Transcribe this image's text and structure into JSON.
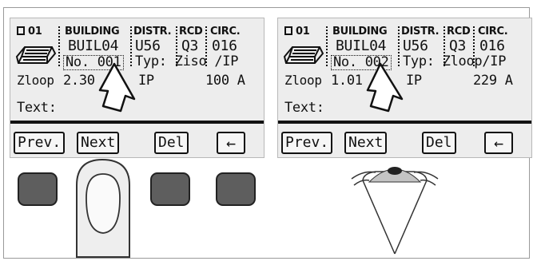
{
  "left_panel": {
    "id_label": "01",
    "headers": {
      "building": "BUILDING",
      "distr": "DISTR.",
      "rcd": "RCD",
      "circ": "CIRC."
    },
    "building_value": "BUIL04",
    "distr_value": "U56",
    "rcd_value": "Q3",
    "circ_value": "016",
    "number": "No. 001",
    "typ": "Typ: Ziso /IP",
    "z_label": "Zloop",
    "z_value": "2.30",
    "ip_label": "IP",
    "ip_value": "100 A",
    "text_label": "Text:",
    "softkeys": {
      "prev": "Prev.",
      "next": "Next",
      "del": "Del",
      "back": "←"
    }
  },
  "right_panel": {
    "id_label": "01",
    "headers": {
      "building": "BUILDING",
      "distr": "DISTR.",
      "rcd": "RCD",
      "circ": "CIRC."
    },
    "building_value": "BUIL04",
    "distr_value": "U56",
    "rcd_value": "Q3",
    "circ_value": "016",
    "number": "No. 002",
    "typ": "Typ: Zloop/IP",
    "z_label": "Zloop",
    "z_value": "1.01",
    "ip_label": "IP",
    "ip_value": "229 A",
    "text_label": "Text:",
    "softkeys": {
      "prev": "Prev.",
      "next": "Next",
      "del": "Del",
      "back": "←"
    }
  },
  "icons": [
    "building-icon",
    "pointer-arrow-icon",
    "finger-icon",
    "eye-icon"
  ],
  "colors": {
    "lcd_background": "#ededed",
    "hardware_button": "#5e5e5e",
    "ink": "#111111"
  }
}
